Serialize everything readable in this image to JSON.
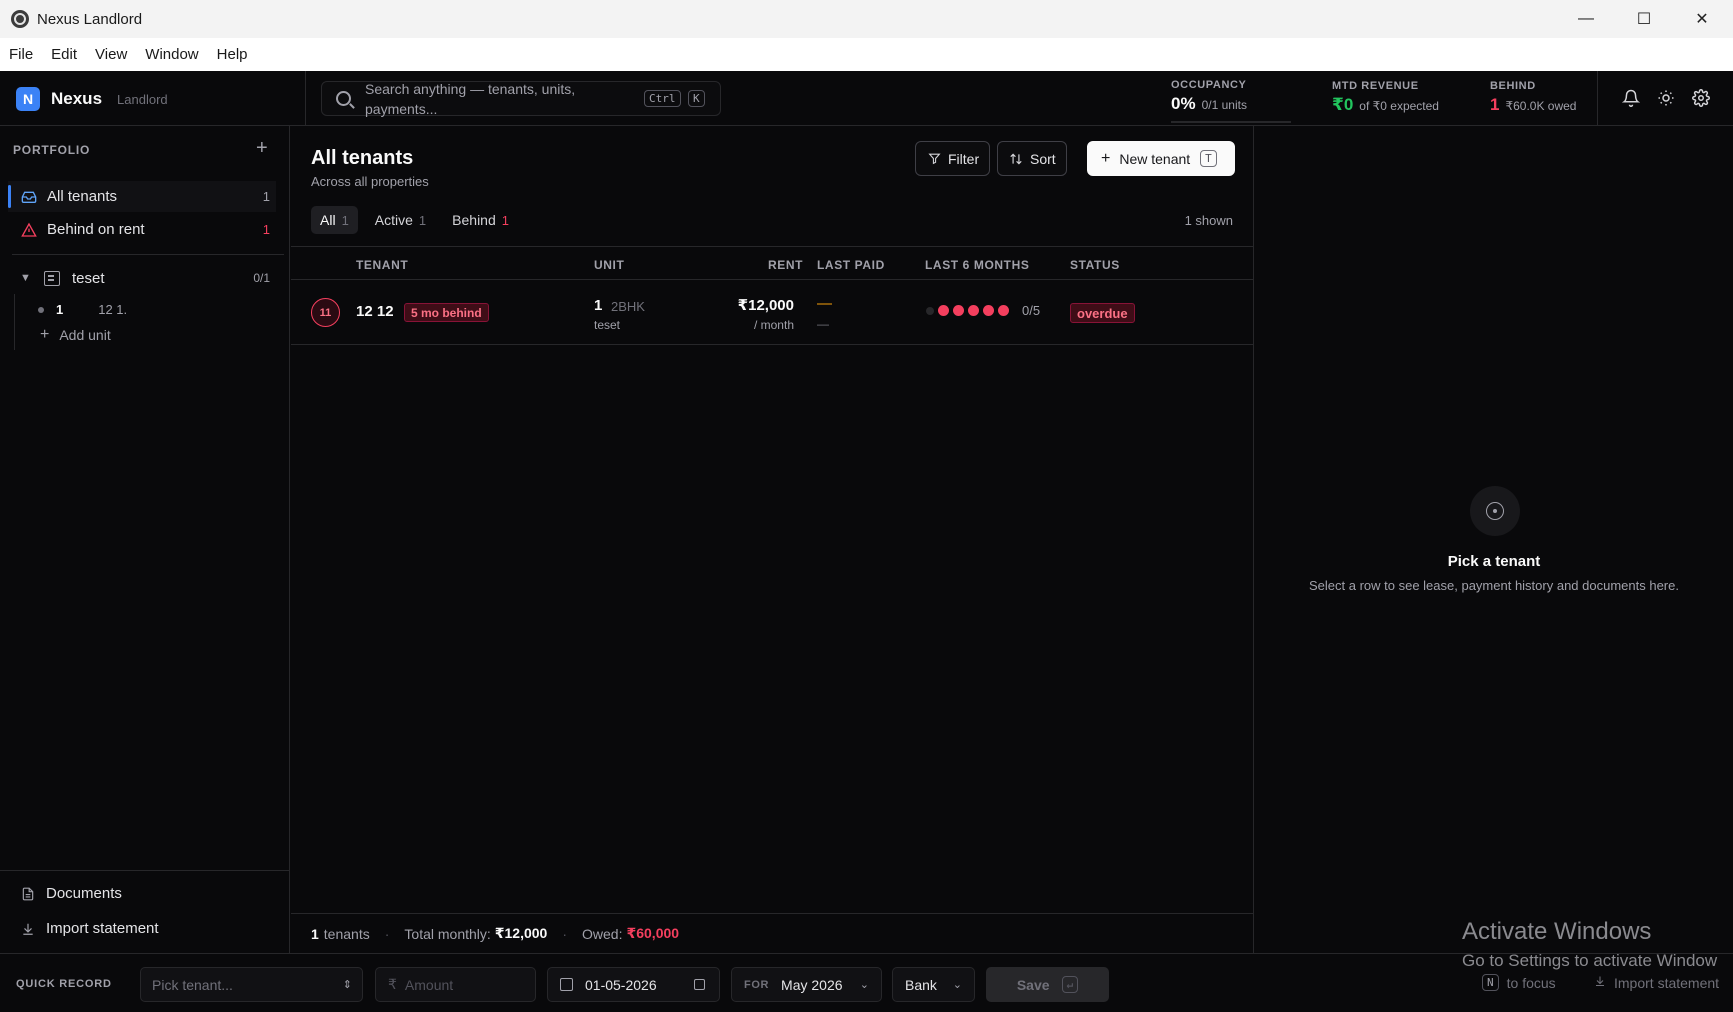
{
  "window": {
    "title": "Nexus Landlord",
    "minimize": "—",
    "maximize": "☐",
    "close": "✕"
  },
  "menu": [
    "File",
    "Edit",
    "View",
    "Window",
    "Help"
  ],
  "header": {
    "logo_letter": "N",
    "brand": "Nexus",
    "role": "Landlord",
    "search_placeholder": "Search anything — tenants, units, payments...",
    "search_kbd": [
      "Ctrl",
      "K"
    ],
    "occupancy": {
      "label": "OCCUPANCY",
      "value": "0%",
      "detail": "0/1 units",
      "fill_fraction": 0
    },
    "mtd_revenue": {
      "label": "MTD REVENUE",
      "value": "₹0",
      "detail": "of ₹0 expected"
    },
    "behind": {
      "label": "BEHIND",
      "value": "1",
      "detail": "₹60.0K owed"
    }
  },
  "sidebar": {
    "heading": "PORTFOLIO",
    "add_label": "+",
    "items": [
      {
        "label": "All tenants",
        "count": "1"
      },
      {
        "label": "Behind on rent",
        "count": "1"
      }
    ],
    "property": {
      "name": "teset",
      "count": "0/1"
    },
    "units": [
      {
        "number": "1",
        "label": "12 1."
      }
    ],
    "add_unit": "Add unit",
    "documents": "Documents",
    "import_statement": "Import statement"
  },
  "main": {
    "title": "All tenants",
    "subtitle": "Across all properties",
    "filter_label": "Filter",
    "sort_label": "Sort",
    "new_tenant_label": "New tenant",
    "new_tenant_kbd": "T",
    "tabs": [
      {
        "label": "All",
        "count": "1"
      },
      {
        "label": "Active",
        "count": "1"
      },
      {
        "label": "Behind",
        "count": "1"
      }
    ],
    "shown": "1 shown",
    "columns": [
      "TENANT",
      "UNIT",
      "RENT",
      "LAST PAID",
      "LAST 6 MONTHS",
      "STATUS"
    ],
    "rows": [
      {
        "avatar": "11",
        "name": "12 12",
        "behind_badge": "5 mo behind",
        "unit_number": "1",
        "unit_type": "2BHK",
        "property": "teset",
        "rent": "₹12,000",
        "rent_period": "/ month",
        "last_paid": "—",
        "last_paid_sub": "—",
        "months_paid": "0/5",
        "status": "overdue"
      }
    ],
    "footer": {
      "tenant_count": "1",
      "tenants_label": "tenants",
      "total_label": "Total monthly:",
      "total_value": "₹12,000",
      "owed_label": "Owed:",
      "owed_value": "₹60,000"
    }
  },
  "detail": {
    "empty_title": "Pick a tenant",
    "empty_subtitle": "Select a row to see lease, payment history and documents here."
  },
  "watermark": {
    "title": "Activate Windows",
    "subtitle": "Go to Settings to activate Window"
  },
  "quick_record": {
    "label": "QUICK RECORD",
    "tenant_placeholder": "Pick tenant...",
    "currency": "₹",
    "amount_placeholder": "Amount",
    "date": "01-05-2026",
    "for_label": "FOR",
    "month": "May 2026",
    "method": "Bank",
    "save_label": "Save",
    "save_kbd": "↵",
    "focus_kbd": "N",
    "focus_label": "to focus",
    "import_label": "Import statement"
  },
  "colors": {
    "accent": "#3b82f6",
    "danger": "#f43f5e",
    "success": "#22c55e",
    "warning": "#f59e0b",
    "background": "#09090b"
  }
}
